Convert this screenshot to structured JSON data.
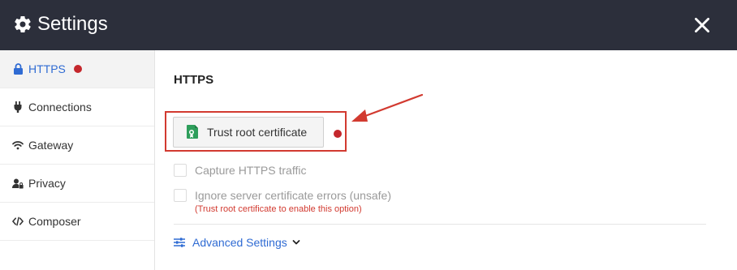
{
  "window": {
    "title": "Settings",
    "title_icon": "gear-icon",
    "close_icon": "close-icon",
    "background_color": "#2c2f3b"
  },
  "sidebar": {
    "items": [
      {
        "label": "HTTPS",
        "icon": "lock-icon",
        "active": true,
        "has_dot": true
      },
      {
        "label": "Connections",
        "icon": "plug-icon",
        "active": false
      },
      {
        "label": "Gateway",
        "icon": "wifi-icon",
        "active": false
      },
      {
        "label": "Privacy",
        "icon": "user-lock-icon",
        "active": false
      },
      {
        "label": "Composer",
        "icon": "code-icon",
        "active": false
      }
    ]
  },
  "main": {
    "section_title": "HTTPS",
    "trust_button": {
      "label": "Trust root certificate",
      "icon": "certificate-icon"
    },
    "capture_https": {
      "label": "Capture HTTPS traffic",
      "checked": false
    },
    "ignore_errors": {
      "label": "Ignore server certificate errors (unsafe)",
      "hint": "(Trust root certificate to enable this option)",
      "checked": false
    },
    "advanced": {
      "label": "Advanced Settings",
      "icon": "sliders-icon"
    }
  },
  "colors": {
    "accent": "#2f6bd3",
    "warning_red": "#c4272c",
    "annotation_red": "#d23a30"
  }
}
